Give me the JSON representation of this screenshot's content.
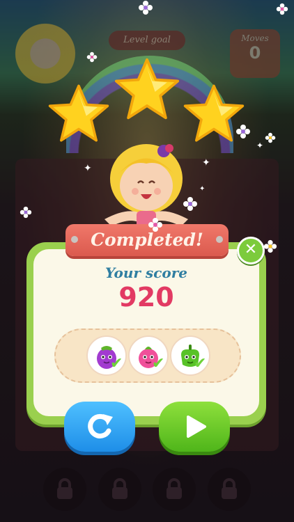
{
  "hud": {
    "level_goal_label": "Level goal",
    "moves_label": "Moves",
    "moves_value": "0"
  },
  "stars_earned": 3,
  "dialog": {
    "title": "Completed!",
    "score_label": "Your score",
    "score_value": "920",
    "goals": [
      {
        "name": "eggplant",
        "completed": true,
        "color": "#a23bd0"
      },
      {
        "name": "onion",
        "completed": true,
        "color": "#f0509a"
      },
      {
        "name": "pepper",
        "completed": true,
        "color": "#58c228"
      }
    ],
    "close_icon": "close-icon",
    "replay_icon": "replay-icon",
    "play_icon": "play-icon"
  },
  "locked_levels": 4,
  "colors": {
    "banner": "#e2645a",
    "panel_border": "#9ad04e",
    "score_label": "#2f7ea1",
    "score_value": "#e23a63",
    "replay_button": "#2ea4f2",
    "play_button": "#6ccb2c"
  }
}
